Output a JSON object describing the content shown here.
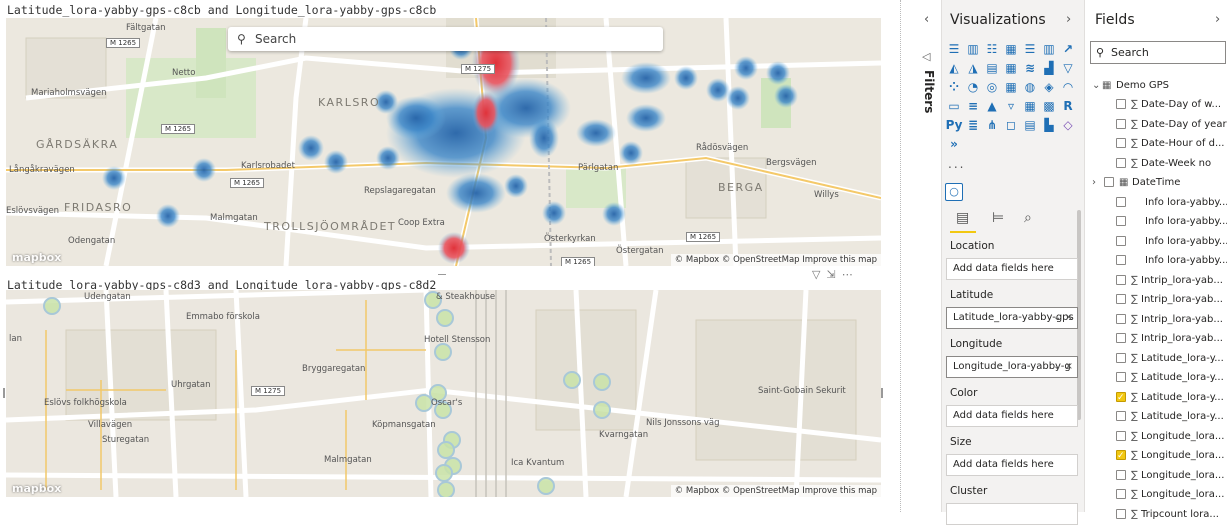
{
  "visual1": {
    "title": "Latitude_lora-yabby-gps-c8cb and Longitude_lora-yabby-gps-c8cb",
    "search_placeholder": "Search",
    "logo": "mapbox",
    "attribution": "© Mapbox © OpenStreetMap  Improve this map",
    "places": [
      "Netto",
      "KARLSRO",
      "GÅRDSÄKRA",
      "Långåkravägen",
      "FRIDASRO",
      "TROLLSJÖOMRÅDET",
      "Coop Extra",
      "BERGA",
      "Willys",
      "Österkyrkan",
      "Pärlgatan",
      "Östergatan",
      "Malmgatan",
      "Karlsrobadet",
      "Rådösvägen",
      "Repslagaregatan",
      "Odengatan",
      "Bergsvägen",
      "Mariaholmsvägen",
      "Eslövsvägen",
      "Fältgatan"
    ],
    "road_shields": [
      "M 1265",
      "M 1275",
      "M 1265",
      "M 1265",
      "M 1265",
      "M 1265",
      "M 1265",
      "M 1265"
    ]
  },
  "visual2": {
    "title": "Latitude_lora-yabby-gps-c8d3 and Longitude_lora-yabby-gps-c8d2",
    "logo": "mapbox",
    "attribution": "© Mapbox © OpenStreetMap  Improve this map",
    "places": [
      "Udengatan",
      "Emmabo förskola",
      "Hotell Stensson",
      "& Steakhouse",
      "Bryggaregatan",
      "Eslövs folkhögskola",
      "Villavägen",
      "Oscar's",
      "Ica Kvantum",
      "Nils Jonssons väg",
      "Saint-Gobain Sekurit",
      "Köpmansgatan",
      "Kvarngatan",
      "Uhrgatan",
      "Sturegatan",
      "lan"
    ],
    "road_shields": [
      "M 1275"
    ]
  },
  "visual_header_icons": [
    "filter-icon",
    "focus-mode-icon",
    "more-options-icon"
  ],
  "filters": {
    "label": "Filters"
  },
  "visualizations": {
    "title": "Visualizations",
    "gallery": [
      "stacked-bar",
      "stacked-column",
      "clustered-bar",
      "clustered-column",
      "100-bar",
      "100-column",
      "line",
      "area",
      "stacked-area",
      "line-column",
      "line-clustered",
      "ribbon",
      "waterfall",
      "funnel",
      "scatter",
      "pie",
      "donut",
      "treemap",
      "map",
      "filled-map",
      "gauge",
      "card",
      "multi-row-card",
      "kpi",
      "slicer",
      "table",
      "matrix",
      "r-visual",
      "python-visual",
      "key-influencers",
      "decomposition-tree",
      "qa",
      "smart-narrative",
      "paginated",
      "power-apps",
      "power-automate"
    ],
    "more": "...",
    "wells": [
      {
        "label": "Location",
        "value": "Add data fields here",
        "filled": false
      },
      {
        "label": "Latitude",
        "value": "Latitude_lora-yabby-gps",
        "filled": true
      },
      {
        "label": "Longitude",
        "value": "Longitude_lora-yabby-g",
        "filled": true
      },
      {
        "label": "Color",
        "value": "Add data fields here",
        "filled": false
      },
      {
        "label": "Size",
        "value": "Add data fields here",
        "filled": false
      },
      {
        "label": "Cluster",
        "value": "",
        "filled": false
      }
    ]
  },
  "fields": {
    "title": "Fields",
    "search_placeholder": "Search",
    "table": "Demo GPS",
    "items": [
      {
        "label": "Date-Day of w...",
        "sigma": true,
        "checked": false
      },
      {
        "label": "Date-Day of year",
        "sigma": true,
        "checked": false
      },
      {
        "label": "Date-Hour of d...",
        "sigma": true,
        "checked": false
      },
      {
        "label": "Date-Week no",
        "sigma": true,
        "checked": false
      },
      {
        "label": "DateTime",
        "sigma": false,
        "checked": false,
        "hierarchy": true
      },
      {
        "label": "Info lora-yabby...",
        "sigma": false,
        "checked": false
      },
      {
        "label": "Info lora-yabby...",
        "sigma": false,
        "checked": false
      },
      {
        "label": "Info lora-yabby...",
        "sigma": false,
        "checked": false
      },
      {
        "label": "Info lora-yabby...",
        "sigma": false,
        "checked": false
      },
      {
        "label": "Intrip_lora-yab...",
        "sigma": true,
        "checked": false
      },
      {
        "label": "Intrip_lora-yab...",
        "sigma": true,
        "checked": false
      },
      {
        "label": "Intrip_lora-yab...",
        "sigma": true,
        "checked": false
      },
      {
        "label": "Intrip_lora-yab...",
        "sigma": true,
        "checked": false
      },
      {
        "label": "Latitude_lora-y...",
        "sigma": true,
        "checked": false
      },
      {
        "label": "Latitude_lora-y...",
        "sigma": true,
        "checked": false
      },
      {
        "label": "Latitude_lora-y...",
        "sigma": true,
        "checked": true
      },
      {
        "label": "Latitude_lora-y...",
        "sigma": true,
        "checked": false
      },
      {
        "label": "Longitude_lora...",
        "sigma": true,
        "checked": false
      },
      {
        "label": "Longitude_lora...",
        "sigma": true,
        "checked": true
      },
      {
        "label": "Longitude_lora...",
        "sigma": true,
        "checked": false
      },
      {
        "label": "Longitude_lora...",
        "sigma": true,
        "checked": false
      },
      {
        "label": "Tripcount lora...",
        "sigma": true,
        "checked": false
      }
    ]
  },
  "colors": {
    "accent": "#f2c811",
    "heat_blue": "#2f7fc1",
    "heat_red": "#e0323a",
    "bubble": "#c9e3a8"
  }
}
